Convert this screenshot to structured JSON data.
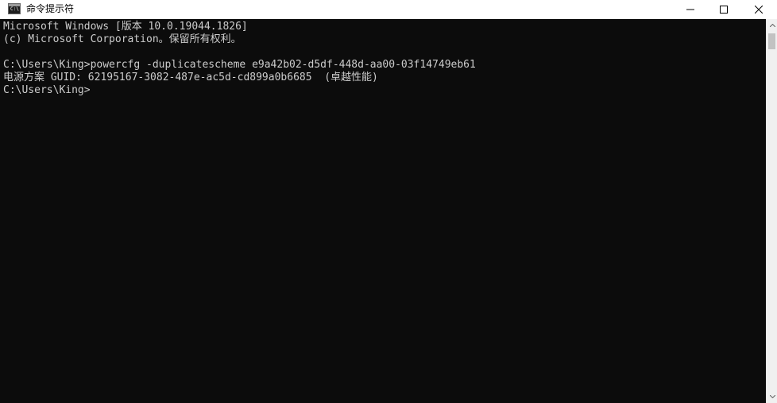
{
  "window": {
    "title": "命令提示符",
    "icon": "cmd-icon",
    "icon_glyph": "C:\\",
    "controls": {
      "minimize": "minimize-icon",
      "maximize": "maximize-icon",
      "close": "close-icon"
    }
  },
  "console": {
    "lines": [
      "Microsoft Windows [版本 10.0.19044.1826]",
      "(c) Microsoft Corporation。保留所有权利。",
      "",
      "C:\\Users\\King>powercfg -duplicatescheme e9a42b02-d5df-448d-aa00-03f14749eb61",
      "电源方案 GUID: 62195167-3082-487e-ac5d-cd899a0b6685  (卓越性能)",
      "C:\\Users\\King>"
    ]
  },
  "colors": {
    "background": "#0c0c0c",
    "text": "#cccccc",
    "titlebar": "#ffffff"
  }
}
